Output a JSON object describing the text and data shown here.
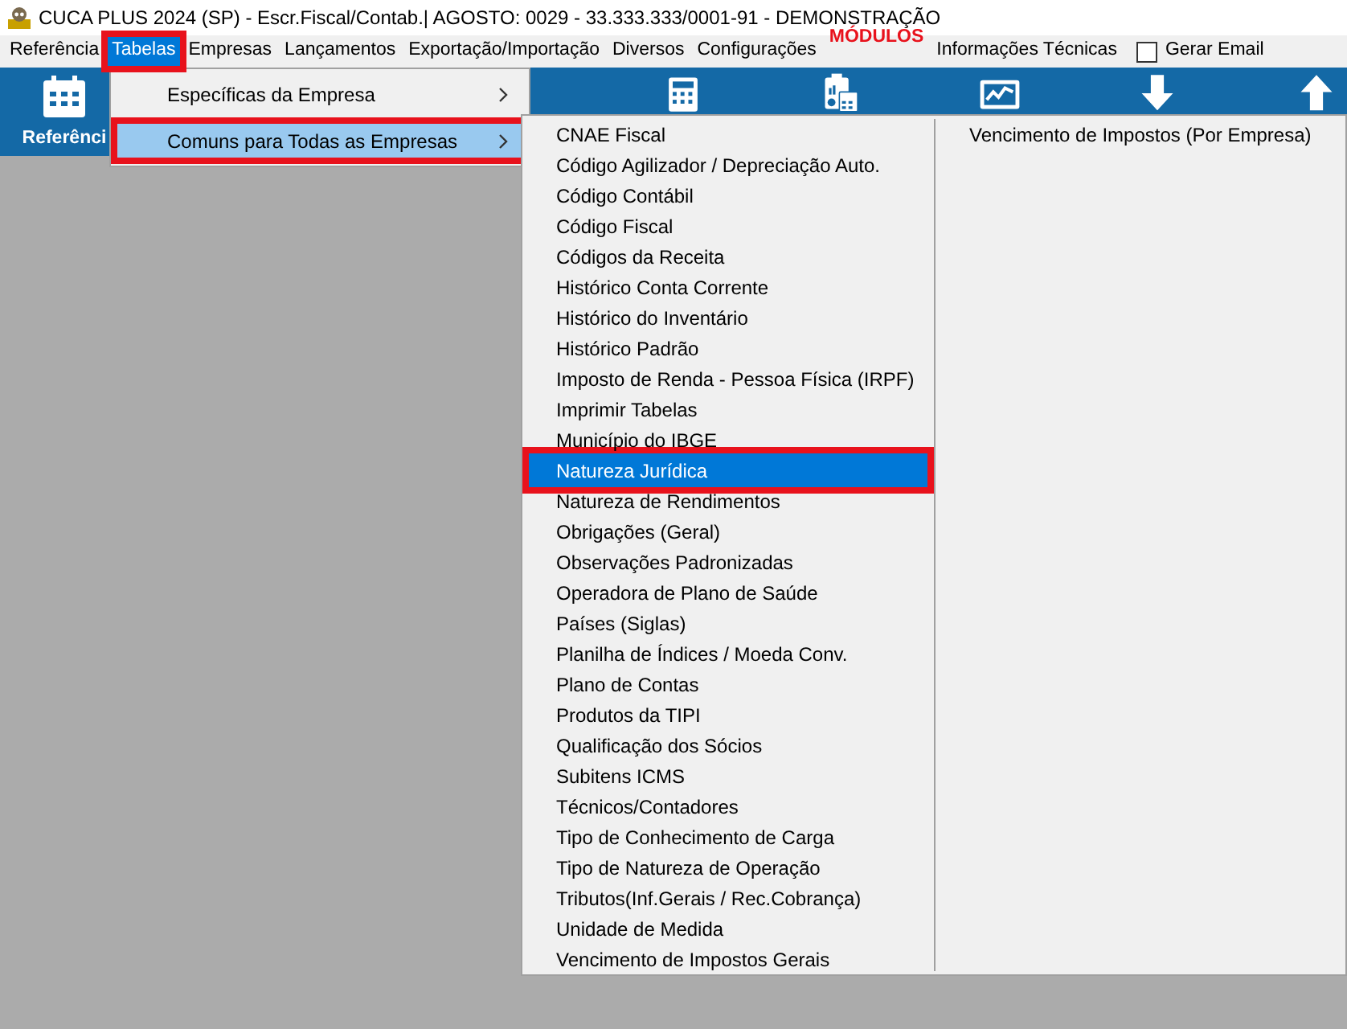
{
  "window": {
    "title": "CUCA PLUS 2024 (SP) - Escr.Fiscal/Contab.| AGOSTO: 0029 - 33.333.333/0001-91 - DEMONSTRAÇÃO"
  },
  "menubar": [
    {
      "label": "Referência",
      "selected": false,
      "highlighted": false,
      "kind": "item"
    },
    {
      "label": "Tabelas",
      "selected": true,
      "highlighted": true,
      "kind": "item"
    },
    {
      "label": "Empresas",
      "selected": false,
      "highlighted": false,
      "kind": "item"
    },
    {
      "label": "Lançamentos",
      "selected": false,
      "highlighted": false,
      "kind": "item"
    },
    {
      "label": "Exportação/Importação",
      "selected": false,
      "highlighted": false,
      "kind": "item"
    },
    {
      "label": "Diversos",
      "selected": false,
      "highlighted": false,
      "kind": "item"
    },
    {
      "label": "Configurações",
      "selected": false,
      "highlighted": false,
      "kind": "item"
    },
    {
      "label": "MÓDULOS",
      "selected": false,
      "highlighted": false,
      "kind": "alert"
    },
    {
      "label": "Informações Técnicas",
      "selected": false,
      "highlighted": false,
      "kind": "item"
    },
    {
      "label": "Gerar Email",
      "checked": false,
      "kind": "checkbox"
    }
  ],
  "toolbar": [
    {
      "kind": "calendar",
      "label": "Referênci"
    },
    {
      "kind": "gap"
    },
    {
      "kind": "gap"
    },
    {
      "kind": "bar"
    },
    {
      "kind": "calculator"
    },
    {
      "kind": "clipboard"
    },
    {
      "kind": "monitor"
    },
    {
      "kind": "down"
    },
    {
      "kind": "up"
    }
  ],
  "menu": [
    {
      "label": "Específicas da Empresa",
      "selected": false,
      "highlighted": false,
      "submenu": true
    },
    {
      "label": "Comuns para Todas as Empresas",
      "selected": true,
      "highlighted": true,
      "submenu": true
    }
  ],
  "submenu": {
    "columns": [
      [
        {
          "label": "CNAE Fiscal",
          "selected": false,
          "highlighted": false
        },
        {
          "label": "Código Agilizador / Depreciação Auto.",
          "selected": false,
          "highlighted": false
        },
        {
          "label": "Código Contábil",
          "selected": false,
          "highlighted": false
        },
        {
          "label": "Código Fiscal",
          "selected": false,
          "highlighted": false
        },
        {
          "label": "Códigos da Receita",
          "selected": false,
          "highlighted": false
        },
        {
          "label": "Histórico Conta Corrente",
          "selected": false,
          "highlighted": false
        },
        {
          "label": "Histórico do Inventário",
          "selected": false,
          "highlighted": false
        },
        {
          "label": "Histórico Padrão",
          "selected": false,
          "highlighted": false
        },
        {
          "label": "Imposto de Renda - Pessoa Física (IRPF)",
          "selected": false,
          "highlighted": false
        },
        {
          "label": "Imprimir Tabelas",
          "selected": false,
          "highlighted": false
        },
        {
          "label": "Município do IBGE",
          "selected": false,
          "highlighted": false
        },
        {
          "label": "Natureza Jurídica",
          "selected": true,
          "highlighted": true
        },
        {
          "label": "Natureza de Rendimentos",
          "selected": false,
          "highlighted": false
        },
        {
          "label": "Obrigações (Geral)",
          "selected": false,
          "highlighted": false
        },
        {
          "label": "Observações Padronizadas",
          "selected": false,
          "highlighted": false
        },
        {
          "label": "Operadora de Plano de Saúde",
          "selected": false,
          "highlighted": false
        },
        {
          "label": "Países (Siglas)",
          "selected": false,
          "highlighted": false
        },
        {
          "label": "Planilha de Índices / Moeda Conv.",
          "selected": false,
          "highlighted": false
        },
        {
          "label": "Plano de Contas",
          "selected": false,
          "highlighted": false
        },
        {
          "label": "Produtos da TIPI",
          "selected": false,
          "highlighted": false
        },
        {
          "label": "Qualificação dos Sócios",
          "selected": false,
          "highlighted": false
        },
        {
          "label": "Subitens ICMS",
          "selected": false,
          "highlighted": false
        },
        {
          "label": "Técnicos/Contadores",
          "selected": false,
          "highlighted": false
        },
        {
          "label": "Tipo de Conhecimento de Carga",
          "selected": false,
          "highlighted": false
        },
        {
          "label": "Tipo de Natureza de Operação",
          "selected": false,
          "highlighted": false
        },
        {
          "label": "Tributos(Inf.Gerais / Rec.Cobrança)",
          "selected": false,
          "highlighted": false
        },
        {
          "label": "Unidade de Medida",
          "selected": false,
          "highlighted": false
        },
        {
          "label": "Vencimento de Impostos Gerais",
          "selected": false,
          "highlighted": false
        }
      ],
      [
        {
          "label": "Vencimento de Impostos (Por Empresa)",
          "selected": false,
          "highlighted": false
        }
      ]
    ]
  }
}
